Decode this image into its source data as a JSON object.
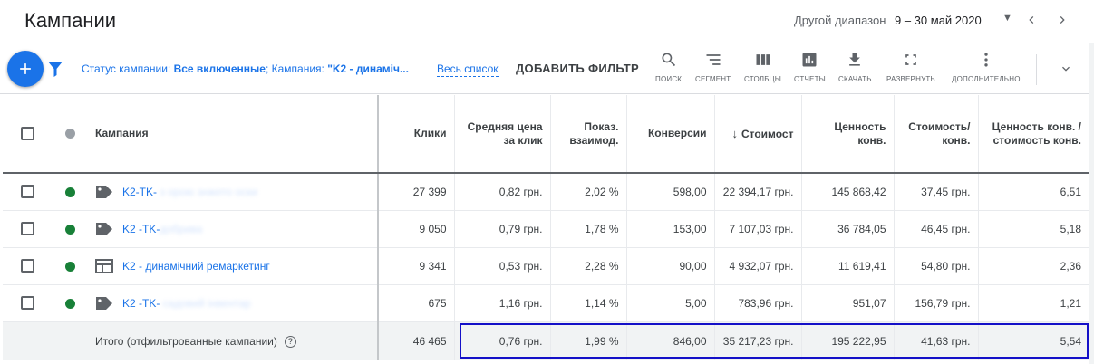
{
  "header": {
    "title": "Кампании",
    "range_label": "Другой диапазон",
    "range_value": "9 – 30 май 2020"
  },
  "toolbar": {
    "filter_prefix": "Статус кампании: ",
    "filter_value": "Все включенные",
    "filter_sep": ";  Кампания: ",
    "filter_campaign": "\"K2 - динаміч...",
    "all_list": "Весь список",
    "add_filter": "ДОБАВИТЬ ФИЛЬТР",
    "tools": [
      {
        "label": "поиск",
        "icon": "search-icon"
      },
      {
        "label": "сегмент",
        "icon": "segment-icon"
      },
      {
        "label": "столбцы",
        "icon": "columns-icon"
      },
      {
        "label": "отчеты",
        "icon": "reports-icon"
      },
      {
        "label": "скачать",
        "icon": "download-icon"
      },
      {
        "label": "развернуть",
        "icon": "expand-icon"
      },
      {
        "label": "дополнительно",
        "icon": "more-vert-icon"
      }
    ]
  },
  "table": {
    "columns": {
      "campaign": "Кампания",
      "clicks": "Клики",
      "avg_cpc": "Средняя цена за клик",
      "interaction_rate": "Показ. взаимод.",
      "conversions": "Конверсии",
      "cost": "Стоимост",
      "conv_value": "Ценность конв.",
      "cost_per_conv": "Стоимость/ конв.",
      "value_per_cost": "Ценность конв. / стоимость конв."
    },
    "rows": [
      {
        "name": "K2-TK-",
        "name_blurred": " з орою знжето оски",
        "type_icon": "tag-icon",
        "status_color": "#188038",
        "clicks": "27 399",
        "avg_cpc": "0,82 грн.",
        "interaction_rate": "2,02 %",
        "conversions": "598,00",
        "cost": "22 394,17 грн.",
        "conv_value": "145 868,42",
        "cost_per_conv": "37,45 грн.",
        "value_per_cost": "6,51"
      },
      {
        "name": "K2 -TK-",
        "name_blurred": "добрива",
        "type_icon": "tag-icon",
        "status_color": "#188038",
        "clicks": "9 050",
        "avg_cpc": "0,79 грн.",
        "interaction_rate": "1,78 %",
        "conversions": "153,00",
        "cost": "7 107,03 грн.",
        "conv_value": "36 784,05",
        "cost_per_conv": "46,45 грн.",
        "value_per_cost": "5,18"
      },
      {
        "name": "K2 - динамічний ремаркетинг",
        "name_blurred": "",
        "type_icon": "display-icon",
        "status_color": "#188038",
        "clicks": "9 341",
        "avg_cpc": "0,53 грн.",
        "interaction_rate": "2,28 %",
        "conversions": "90,00",
        "cost": "4 932,07 грн.",
        "conv_value": "11 619,41",
        "cost_per_conv": "54,80 грн.",
        "value_per_cost": "2,36"
      },
      {
        "name": "K2 -TK-",
        "name_blurred": " садовий інвентар",
        "type_icon": "tag-icon",
        "status_color": "#188038",
        "clicks": "675",
        "avg_cpc": "1,16 грн.",
        "interaction_rate": "1,14 %",
        "conversions": "5,00",
        "cost": "783,96 грн.",
        "conv_value": "951,07",
        "cost_per_conv": "156,79 грн.",
        "value_per_cost": "1,21"
      }
    ],
    "total": {
      "label": "Итого (отфильтрованные кампании)",
      "clicks": "46 465",
      "avg_cpc": "0,76 грн.",
      "interaction_rate": "1,99 %",
      "conversions": "846,00",
      "cost": "35 217,23 грн.",
      "conv_value": "195 222,95",
      "cost_per_conv": "41,63 грн.",
      "value_per_cost": "5,54"
    }
  },
  "colors": {
    "accent": "#1a73e8",
    "status_enabled": "#188038",
    "highlight_border": "#1410c8"
  }
}
